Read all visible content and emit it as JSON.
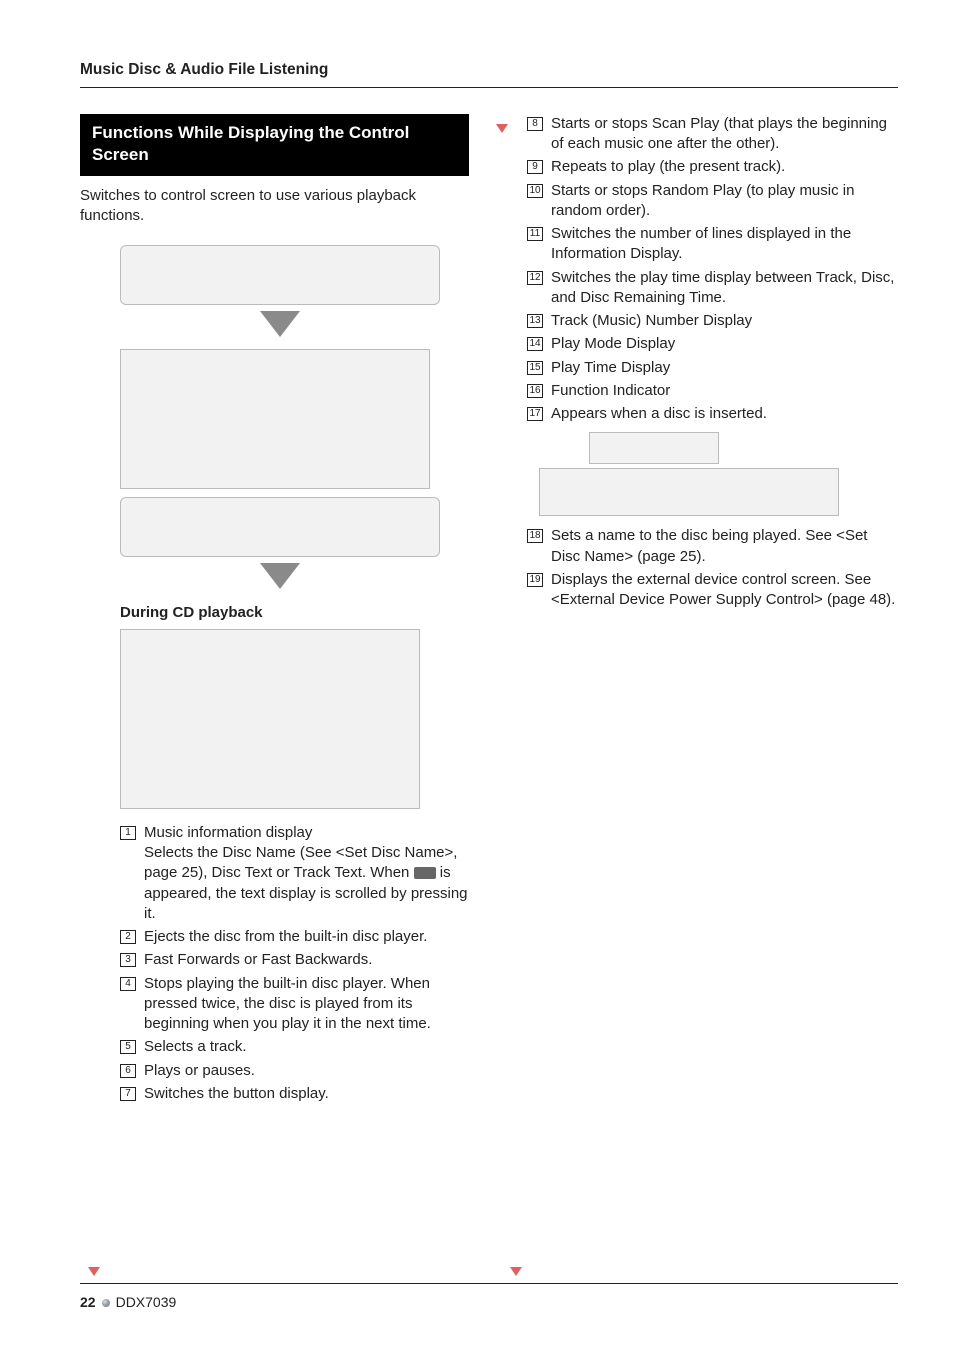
{
  "header": {
    "section_title": "Music Disc & Audio File Listening"
  },
  "left": {
    "box_title": "Functions While Displaying the Control Screen",
    "intro": "Switches to control screen to use various playback functions.",
    "sub_heading": "During CD playback",
    "items": [
      {
        "n": "1",
        "text_a": "Music information display",
        "text_b": "Selects the Disc Name (See <Set Disc Name>, page 25), Disc Text or Track Text. When ",
        "text_c": " is appeared, the text display is scrolled by pressing it."
      },
      {
        "n": "2",
        "text": "Ejects the disc from the built-in disc player."
      },
      {
        "n": "3",
        "text": "Fast Forwards or Fast Backwards."
      },
      {
        "n": "4",
        "text": "Stops playing the built-in disc player. When pressed twice, the disc is played from its beginning when you play it in the next time."
      },
      {
        "n": "5",
        "text": "Selects a track."
      },
      {
        "n": "6",
        "text": "Plays or pauses."
      },
      {
        "n": "7",
        "text": "Switches the button display."
      }
    ]
  },
  "right": {
    "items_a": [
      {
        "n": "8",
        "text": "Starts or stops Scan Play (that plays the beginning of each music one after the other)."
      },
      {
        "n": "9",
        "text": "Repeats to play (the present track)."
      },
      {
        "n": "10",
        "text": "Starts or stops Random Play (to play music in random order)."
      },
      {
        "n": "11",
        "text": "Switches the number of lines displayed in the Information Display."
      },
      {
        "n": "12",
        "text": "Switches the play time display between Track, Disc, and Disc Remaining Time."
      },
      {
        "n": "13",
        "text": "Track (Music) Number Display"
      },
      {
        "n": "14",
        "text": "Play Mode Display"
      },
      {
        "n": "15",
        "text": "Play Time Display"
      },
      {
        "n": "16",
        "text": "Function Indicator"
      },
      {
        "n": "17",
        "text": "Appears when a disc is inserted."
      }
    ],
    "items_b": [
      {
        "n": "18",
        "text": "Sets a name to the disc being played. See <Set Disc Name> (page 25)."
      },
      {
        "n": "19",
        "text": "Displays the external device control screen. See <External Device Power Supply Control> (page 48)."
      }
    ]
  },
  "footer": {
    "page": "22",
    "model": "DDX7039"
  }
}
